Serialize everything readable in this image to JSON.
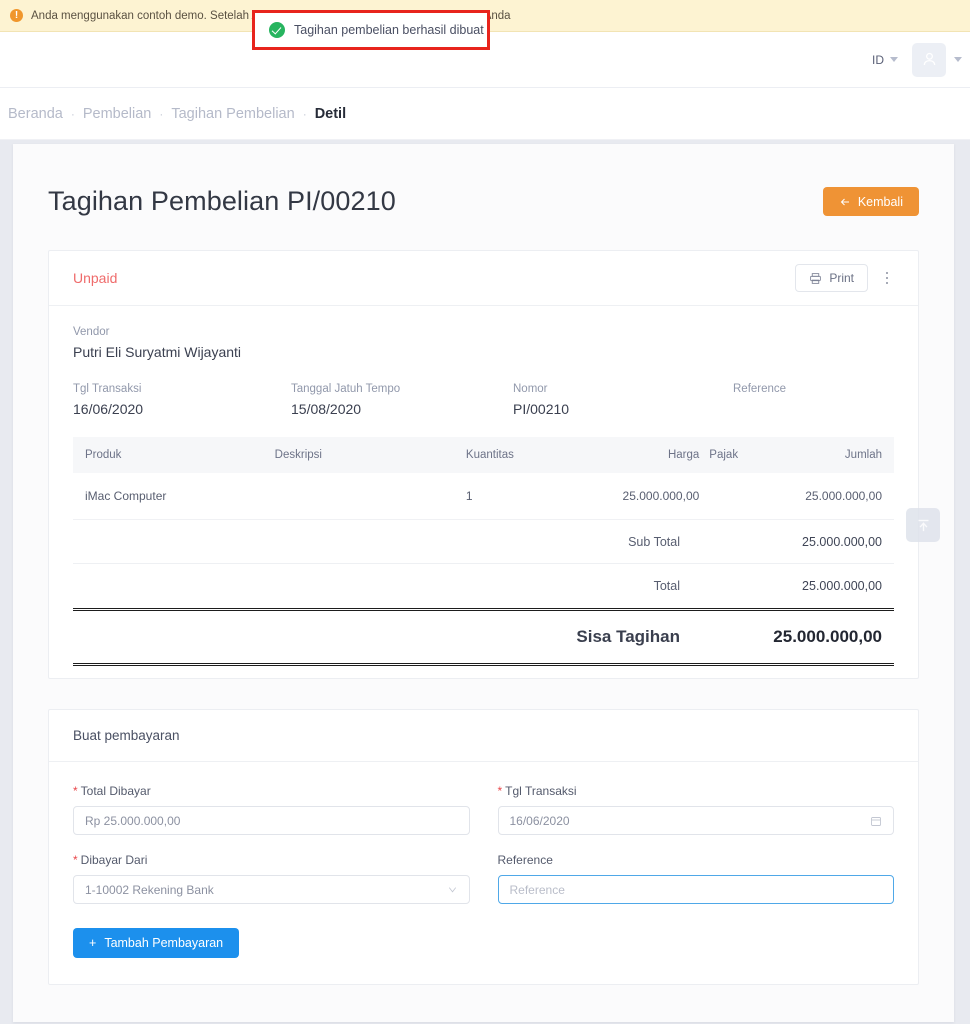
{
  "banner": {
    "icon": "warning-icon",
    "text": "Anda menggunakan contoh demo. Setelah Anda buat bulk dibuat ... uangan perusahaan Anda"
  },
  "toast": {
    "icon": "success-check-icon",
    "message": "Tagihan pembelian berhasil dibuat"
  },
  "topbar": {
    "language": "ID",
    "avatar_icon": "user-avatar-icon"
  },
  "breadcrumb": {
    "items": [
      {
        "label": "Beranda",
        "active": false
      },
      {
        "label": "Pembelian",
        "active": false
      },
      {
        "label": "Tagihan Pembelian",
        "active": false
      },
      {
        "label": "Detil",
        "active": true
      }
    ],
    "separator": "·"
  },
  "page": {
    "title": "Tagihan Pembelian PI/00210",
    "back_button": "Kembali",
    "back_icon": "arrow-left-icon"
  },
  "invoice": {
    "status": "Unpaid",
    "print_label": "Print",
    "print_icon": "printer-icon",
    "more_icon": "kebab-menu-icon",
    "vendor_label": "Vendor",
    "vendor_value": "Putri Eli Suryatmi Wijayanti",
    "meta": [
      {
        "label": "Tgl Transaksi",
        "value": "16/06/2020"
      },
      {
        "label": "Tanggal Jatuh Tempo",
        "value": "15/08/2020"
      },
      {
        "label": "Nomor",
        "value": "PI/00210"
      },
      {
        "label": "Reference",
        "value": ""
      }
    ],
    "table": {
      "headers": [
        "Produk",
        "Deskripsi",
        "Kuantitas",
        "Harga",
        "Pajak",
        "Jumlah"
      ],
      "rows": [
        {
          "produk": "iMac Computer",
          "deskripsi": "",
          "kuantitas": "1",
          "harga": "25.000.000,00",
          "pajak": "",
          "jumlah": "25.000.000,00"
        }
      ]
    },
    "totals": [
      {
        "label": "Sub Total",
        "value": "25.000.000,00"
      },
      {
        "label": "Total",
        "value": "25.000.000,00"
      }
    ],
    "grand_total": {
      "label": "Sisa Tagihan",
      "value": "25.000.000,00"
    }
  },
  "payment": {
    "title": "Buat pembayaran",
    "fields": {
      "total_dibayar": {
        "label": "Total Dibayar",
        "required": true,
        "value": "Rp 25.000.000,00",
        "placeholder": "Rp 25.000.000,00"
      },
      "tgl_transaksi": {
        "label": "Tgl Transaksi",
        "required": true,
        "value": "16/06/2020",
        "placeholder": "16/06/2020",
        "icon": "calendar-icon"
      },
      "dibayar_dari": {
        "label": "Dibayar Dari",
        "required": true,
        "value": "1-10002 Rekening Bank",
        "icon": "chevron-down-icon"
      },
      "reference": {
        "label": "Reference",
        "required": false,
        "value": "",
        "placeholder": "Reference"
      }
    },
    "submit": {
      "label": "Tambah Pembayaran",
      "icon": "plus-icon"
    }
  },
  "fab": {
    "icon": "scroll-to-top-icon"
  },
  "colors": {
    "banner_bg": "#fdf3d2",
    "accent_orange": "#ef9335",
    "status_unpaid": "#ef6b6b",
    "primary_blue": "#1c90ed",
    "success_green": "#27b45f",
    "toast_border": "#e8241c"
  }
}
